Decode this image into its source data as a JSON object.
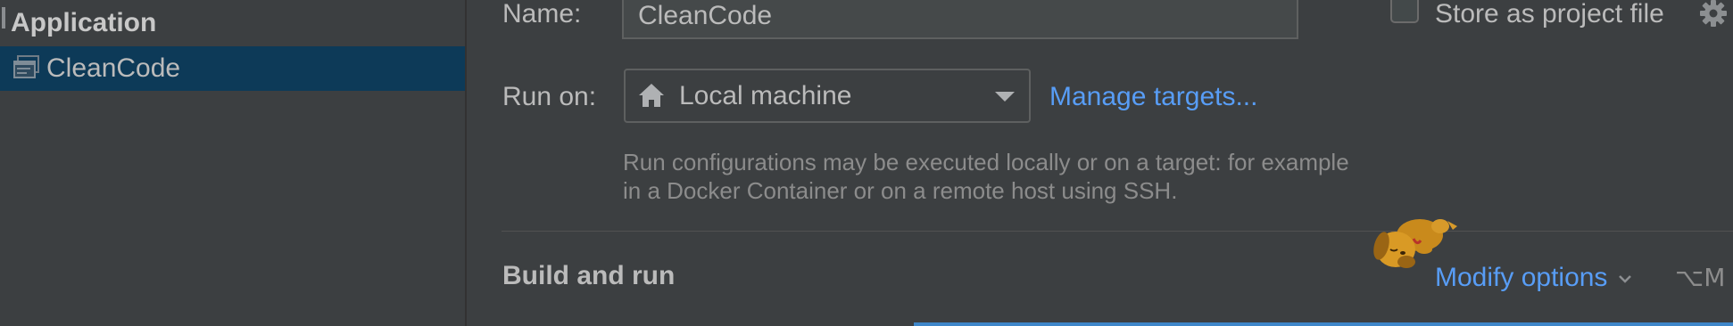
{
  "sidebar": {
    "group_label": "Application",
    "items": [
      {
        "label": "CleanCode",
        "icon": "application-config-icon",
        "selected": true
      }
    ]
  },
  "form": {
    "name_label": "Name:",
    "name_value": "CleanCode",
    "store_checkbox_label": "Store as project file",
    "store_checked": false,
    "run_on_label": "Run on:",
    "run_on_value": "Local machine",
    "run_on_icon": "home-icon",
    "manage_targets_link": "Manage targets...",
    "help_text_line1": "Run configurations may be executed locally or on a target: for example",
    "help_text_line2": "in a Docker Container or on a remote host using SSH."
  },
  "build_and_run": {
    "section_title": "Build and run",
    "modify_options_label": "Modify options",
    "modify_options_shortcut": "⌥M"
  },
  "colors": {
    "background": "#3c3f41",
    "selection": "#0d3a58",
    "link": "#589df6",
    "text": "#bbbbbb",
    "muted_text": "#8c8c8c",
    "accent_bar": "#3e86c9"
  }
}
